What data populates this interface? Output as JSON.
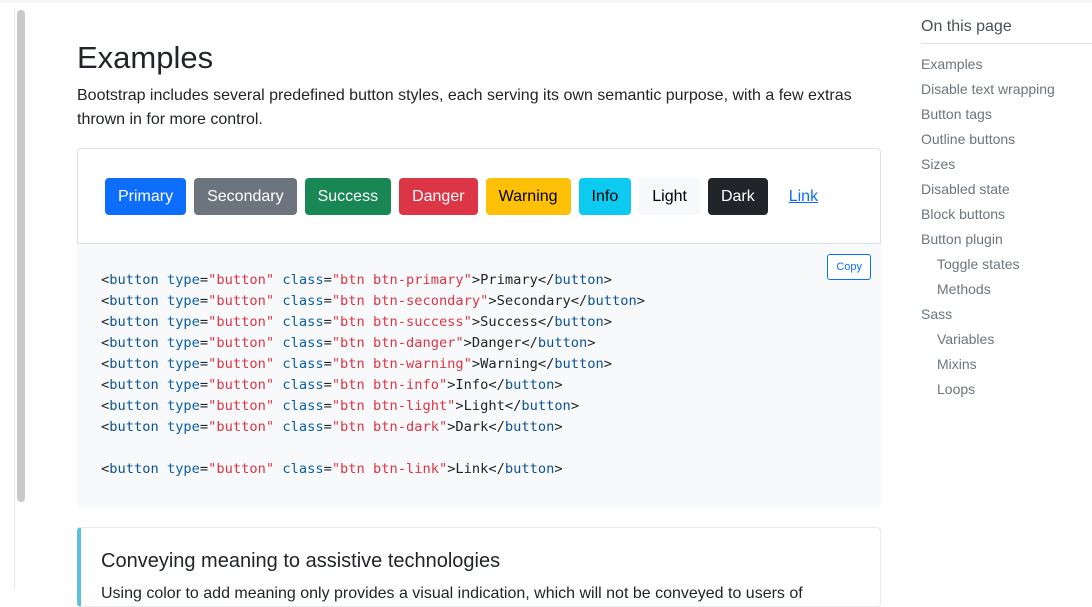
{
  "page": {
    "title": "Examples",
    "lead": "Bootstrap includes several predefined button styles, each serving its own semantic purpose, with a few extras thrown in for more control."
  },
  "example": {
    "buttons": [
      {
        "label": "Primary",
        "variant": "primary"
      },
      {
        "label": "Secondary",
        "variant": "secondary"
      },
      {
        "label": "Success",
        "variant": "success"
      },
      {
        "label": "Danger",
        "variant": "danger"
      },
      {
        "label": "Warning",
        "variant": "warning"
      },
      {
        "label": "Info",
        "variant": "info"
      },
      {
        "label": "Light",
        "variant": "light"
      },
      {
        "label": "Dark",
        "variant": "dark"
      },
      {
        "label": "Link",
        "variant": "link"
      }
    ],
    "copy_label": "Copy"
  },
  "code": {
    "lines": [
      {
        "cls": "btn btn-primary",
        "text": "Primary"
      },
      {
        "cls": "btn btn-secondary",
        "text": "Secondary"
      },
      {
        "cls": "btn btn-success",
        "text": "Success"
      },
      {
        "cls": "btn btn-danger",
        "text": "Danger"
      },
      {
        "cls": "btn btn-warning",
        "text": "Warning"
      },
      {
        "cls": "btn btn-info",
        "text": "Info"
      },
      {
        "cls": "btn btn-light",
        "text": "Light"
      },
      {
        "cls": "btn btn-dark",
        "text": "Dark"
      },
      {
        "blank": true
      },
      {
        "cls": "btn btn-link",
        "text": "Link"
      }
    ]
  },
  "callout": {
    "title": "Conveying meaning to assistive technologies",
    "text": "Using color to add meaning only provides a visual indication, which will not be conveyed to users of"
  },
  "toc": {
    "heading": "On this page",
    "items": [
      {
        "label": "Examples",
        "level": 1
      },
      {
        "label": "Disable text wrapping",
        "level": 1
      },
      {
        "label": "Button tags",
        "level": 1
      },
      {
        "label": "Outline buttons",
        "level": 1
      },
      {
        "label": "Sizes",
        "level": 1
      },
      {
        "label": "Disabled state",
        "level": 1
      },
      {
        "label": "Block buttons",
        "level": 1
      },
      {
        "label": "Button plugin",
        "level": 1
      },
      {
        "label": "Toggle states",
        "level": 2
      },
      {
        "label": "Methods",
        "level": 2
      },
      {
        "label": "Sass",
        "level": 1
      },
      {
        "label": "Variables",
        "level": 2
      },
      {
        "label": "Mixins",
        "level": 2
      },
      {
        "label": "Loops",
        "level": 2
      }
    ]
  },
  "colors": {
    "primary": "#0d6efd",
    "secondary": "#6c757d",
    "success": "#198754",
    "danger": "#dc3545",
    "warning": "#ffc107",
    "info": "#0dcaf0",
    "light": "#f8f9fa",
    "dark": "#212529",
    "callout_border": "#5bc0de"
  }
}
